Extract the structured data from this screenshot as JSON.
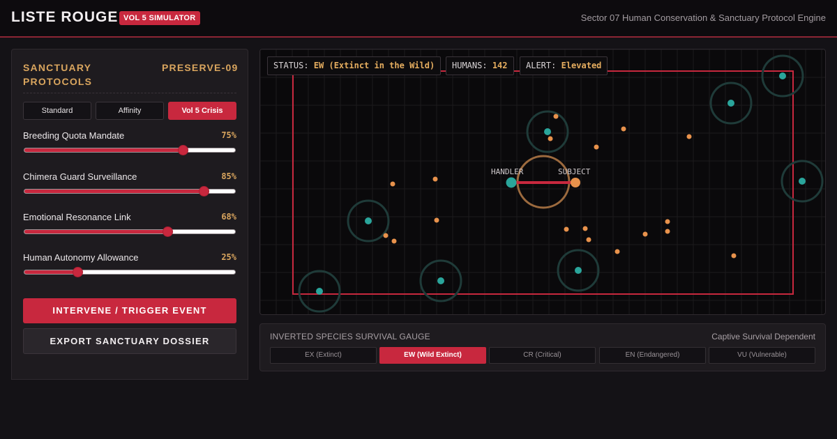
{
  "header": {
    "brand": "LISTE ROUGE",
    "badge": "VOL 5 SIMULATOR",
    "subtitle": "Sector 07 Human Conservation & Sanctuary Protocol Engine"
  },
  "panel": {
    "title": "SANCTUARY PROTOCOLS",
    "preserve_id": "PRESERVE-09",
    "modes": [
      {
        "label": "Standard",
        "active": false
      },
      {
        "label": "Affinity",
        "active": false
      },
      {
        "label": "Vol 5 Crisis",
        "active": true
      }
    ],
    "sliders": [
      {
        "label": "Breeding Quota Mandate",
        "value": 75,
        "value_text": "75%"
      },
      {
        "label": "Chimera Guard Surveillance",
        "value": 85,
        "value_text": "85%"
      },
      {
        "label": "Emotional Resonance Link",
        "value": 68,
        "value_text": "68%"
      },
      {
        "label": "Human Autonomy Allowance",
        "value": 25,
        "value_text": "25%"
      }
    ],
    "primary_action": "INTERVENE / TRIGGER EVENT",
    "secondary_action": "EXPORT SANCTUARY DOSSIER"
  },
  "sim": {
    "status_label": "STATUS:",
    "status_value": "EW (Extinct in the Wild)",
    "humans_label": "HUMANS:",
    "humans_value": "142",
    "alert_label": "ALERT:",
    "alert_value": "Elevated",
    "handler_label": "HANDLER",
    "subject_label": "SUBJECT",
    "colors": {
      "boundary": "#c8283e",
      "guard": "#2aa59b",
      "human": "#e8924c",
      "bond": "#c8283e",
      "ring": "#9c6a3e"
    }
  },
  "gauge": {
    "title": "INVERTED SPECIES SURVIVAL GAUGE",
    "note": "Captive Survival Dependent",
    "segments": [
      {
        "label": "EX (Extinct)",
        "active": false
      },
      {
        "label": "EW (Wild Extinct)",
        "active": true
      },
      {
        "label": "CR (Critical)",
        "active": false
      },
      {
        "label": "EN (Endangered)",
        "active": false
      },
      {
        "label": "VU (Vulnerable)",
        "active": false
      }
    ]
  }
}
